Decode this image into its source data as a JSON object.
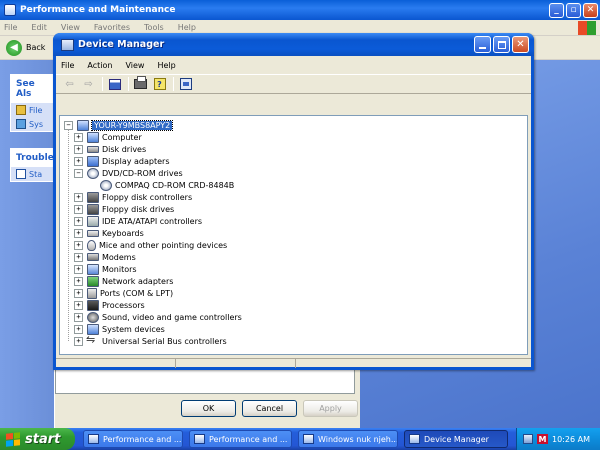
{
  "background_window": {
    "title": "Performance and Maintenance",
    "menu": [
      "File",
      "Edit",
      "View",
      "Favorites",
      "Tools",
      "Help"
    ],
    "back_label": "Back",
    "see_also": {
      "heading": "See Als",
      "items": [
        "File",
        "Sys"
      ]
    },
    "troubleshoot": {
      "heading": "Trouble",
      "items": [
        "Sta"
      ]
    }
  },
  "dialog_buttons": {
    "ok": "OK",
    "cancel": "Cancel",
    "apply": "Apply"
  },
  "device_manager": {
    "title": "Device Manager",
    "menu": [
      "File",
      "Action",
      "View",
      "Help"
    ],
    "root": "YOUR-Y9MBS8APY2",
    "categories": [
      {
        "label": "Computer",
        "icon": "computer-icon",
        "expanded": false
      },
      {
        "label": "Disk drives",
        "icon": "disk-drive-icon",
        "expanded": false
      },
      {
        "label": "Display adapters",
        "icon": "display-adapter-icon",
        "expanded": false
      },
      {
        "label": "DVD/CD-ROM drives",
        "icon": "cdrom-drive-icon",
        "expanded": true
      },
      {
        "label": "Floppy disk controllers",
        "icon": "floppy-controller-icon",
        "expanded": false
      },
      {
        "label": "Floppy disk drives",
        "icon": "floppy-drive-icon",
        "expanded": false
      },
      {
        "label": "IDE ATA/ATAPI controllers",
        "icon": "ide-controller-icon",
        "expanded": false
      },
      {
        "label": "Keyboards",
        "icon": "keyboard-icon",
        "expanded": false
      },
      {
        "label": "Mice and other pointing devices",
        "icon": "mouse-icon",
        "expanded": false
      },
      {
        "label": "Modems",
        "icon": "modem-icon",
        "expanded": false
      },
      {
        "label": "Monitors",
        "icon": "monitor-icon",
        "expanded": false
      },
      {
        "label": "Network adapters",
        "icon": "network-adapter-icon",
        "expanded": false
      },
      {
        "label": "Ports (COM & LPT)",
        "icon": "port-icon",
        "expanded": false
      },
      {
        "label": "Processors",
        "icon": "processor-icon",
        "expanded": false
      },
      {
        "label": "Sound, video and game controllers",
        "icon": "sound-icon",
        "expanded": false
      },
      {
        "label": "System devices",
        "icon": "system-device-icon",
        "expanded": false
      },
      {
        "label": "Universal Serial Bus controllers",
        "icon": "usb-icon",
        "expanded": false
      }
    ],
    "dvd_child": "COMPAQ CD-ROM CRD-8484B"
  },
  "taskbar": {
    "start": "start",
    "buttons": [
      {
        "label": "Performance and ...",
        "active": false
      },
      {
        "label": "Performance and ...",
        "active": false
      },
      {
        "label": "Windows nuk njeh...",
        "active": false
      },
      {
        "label": "Device Manager",
        "active": true
      }
    ],
    "clock": "10:26 AM",
    "tray_m": "M"
  }
}
